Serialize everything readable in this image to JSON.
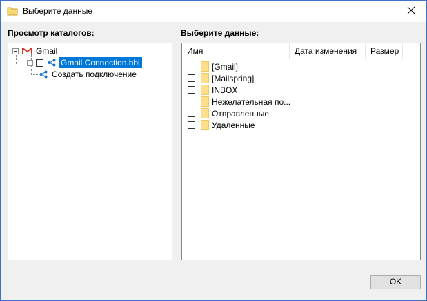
{
  "window": {
    "title": "Выберите данные"
  },
  "left_panel": {
    "label": "Просмотр каталогов:",
    "tree": {
      "root": "Gmail",
      "connection": "Gmail Connection.hbl",
      "create": "Создать подключение"
    }
  },
  "right_panel": {
    "label": "Выберите данные:",
    "columns": [
      "Имя",
      "Дата изменения",
      "Размер"
    ],
    "items": [
      "[Gmail]",
      "[Mailspring]",
      "INBOX",
      "Нежелательная по...",
      "Отправленные",
      "Удаленные"
    ]
  },
  "buttons": {
    "ok": "OK"
  },
  "colors": {
    "selection": "#0078d7",
    "folder": "#ffe08a",
    "window_border": "#3c73c8"
  },
  "icons": [
    "folder-icon",
    "gmail-icon",
    "share-icon",
    "close-icon"
  ]
}
